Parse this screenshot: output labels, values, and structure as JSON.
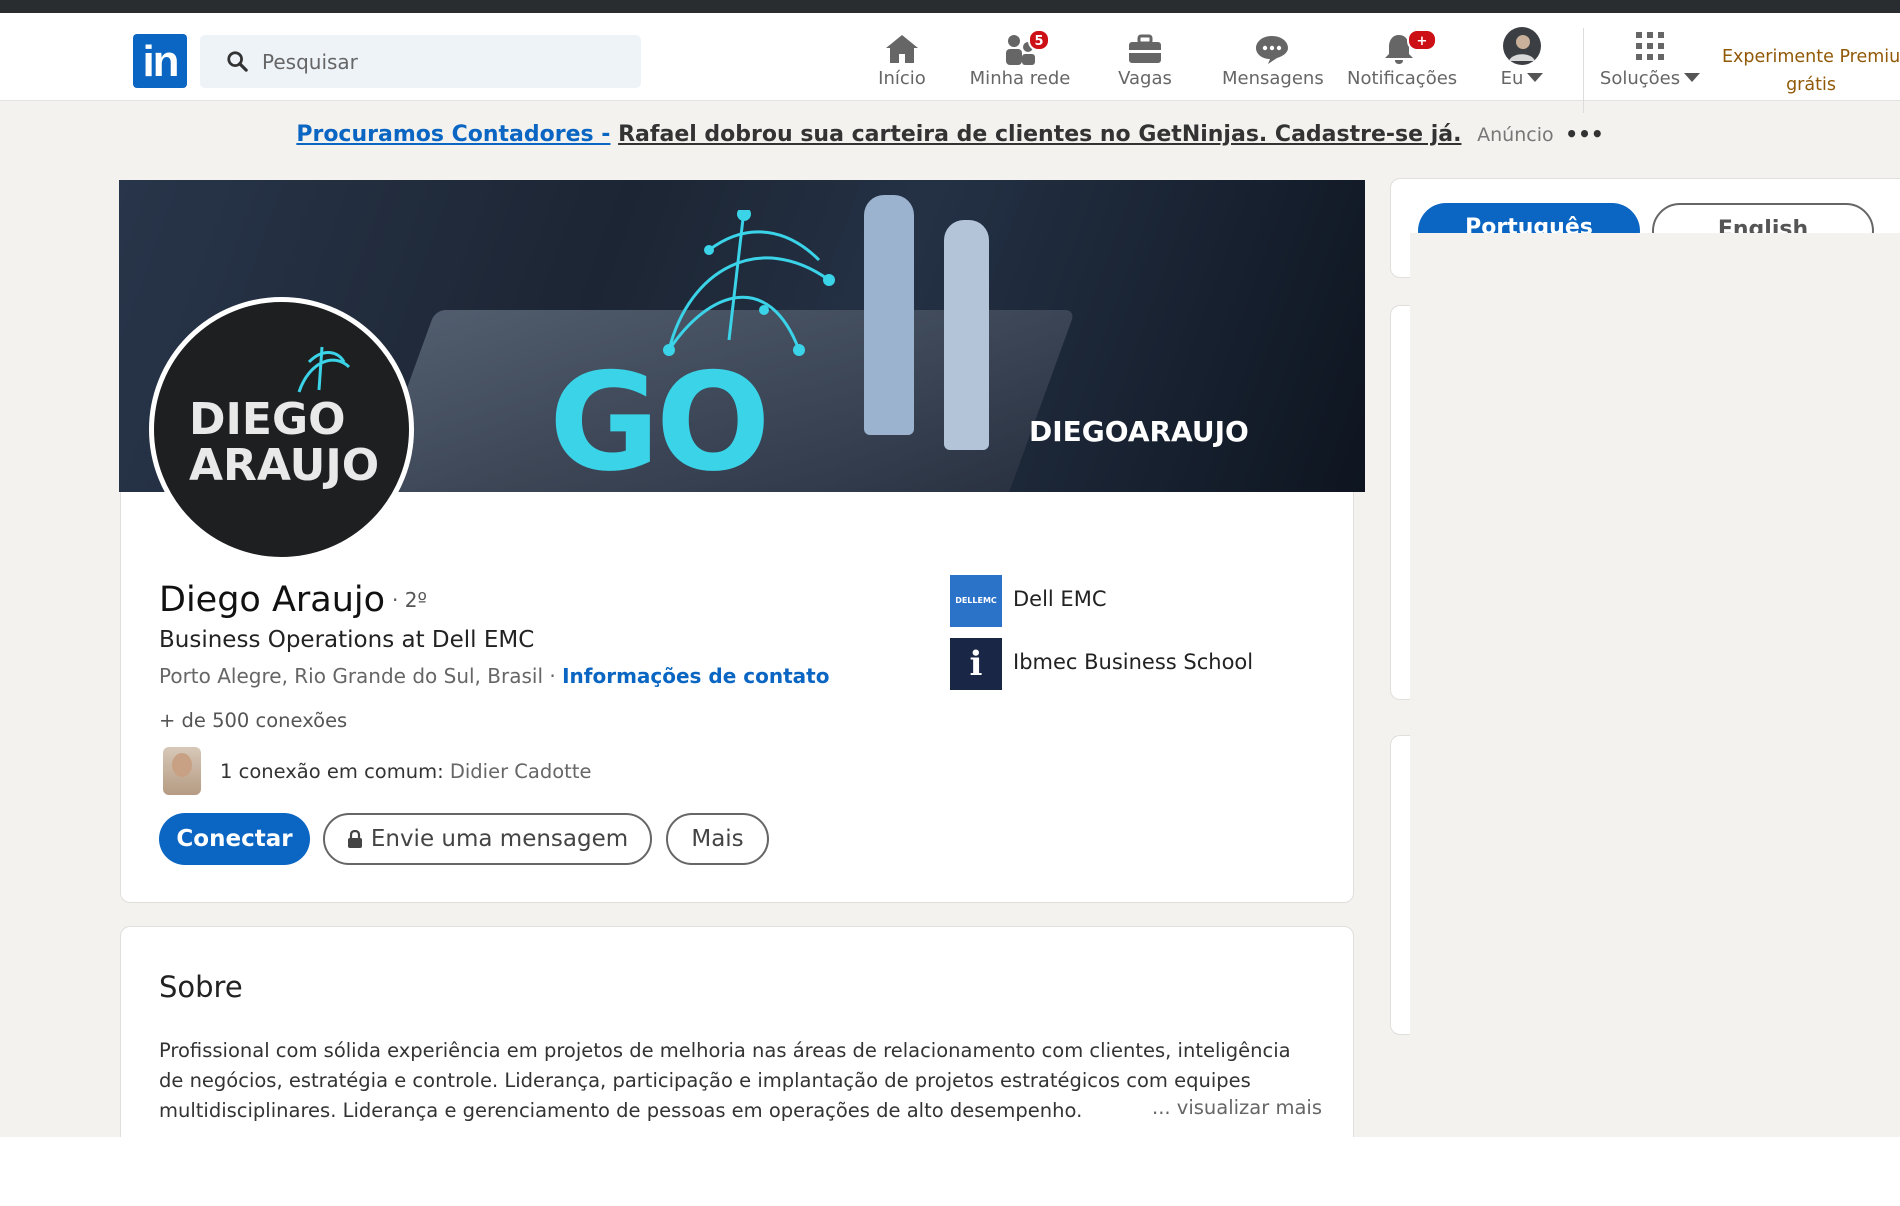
{
  "nav": {
    "search_placeholder": "Pesquisar",
    "items": [
      {
        "label": "Início"
      },
      {
        "label": "Minha rede",
        "badge": "5"
      },
      {
        "label": "Vagas"
      },
      {
        "label": "Mensagens"
      },
      {
        "label": "Notificações",
        "badge": "+"
      },
      {
        "label": "Eu"
      },
      {
        "label": "Soluções"
      }
    ],
    "premium_line1": "Experimente Premium",
    "premium_line2": "grátis",
    "logo_text": "in"
  },
  "ad": {
    "link": "Procuramos Contadores -",
    "text": "Rafael dobrou sua carteira de clientes no GetNinjas. Cadastre-se já.",
    "tag": "Anúncio",
    "more": "•••"
  },
  "cover": {
    "logo_word": "GO",
    "brand": "DIEGOARAUJO"
  },
  "avatar": {
    "line1": "DIEGO",
    "line2": "ARAUJO"
  },
  "profile": {
    "name": "Diego Araujo",
    "degree": "· 2º",
    "headline": "Business Operations at Dell EMC",
    "location": "Porto Alegre, Rio Grande do Sul, Brasil ·",
    "contact_link": "Informações de contato",
    "connections": "+ de 500 conexões",
    "mutual_label": "1 conexão em comum:",
    "mutual_name": "Didier Cadotte"
  },
  "actions": {
    "connect": "Conectar",
    "message": "Envie uma mensagem",
    "more": "Mais"
  },
  "experience": [
    {
      "name": "Dell EMC",
      "logo_text": "DELLEMC"
    },
    {
      "name": "Ibmec Business School",
      "logo_text": "i"
    }
  ],
  "about": {
    "title": "Sobre",
    "body": "Profissional com sólida experiência em projetos de melhoria nas áreas de relacionamento com clientes, inteligência de negócios, estratégia e controle. Liderança, participação e implantação de projetos estratégicos com equipes multidisciplinares. Liderança e gerenciamento de pessoas em operações de alto desempenho.",
    "more": "... visualizar mais"
  },
  "languages": {
    "pt": "Português",
    "en": "English"
  },
  "colors": {
    "brand_blue": "#0a66c2",
    "badge_red": "#cc1016",
    "premium_gold": "#915907",
    "page_bg": "#f3f2ef"
  }
}
